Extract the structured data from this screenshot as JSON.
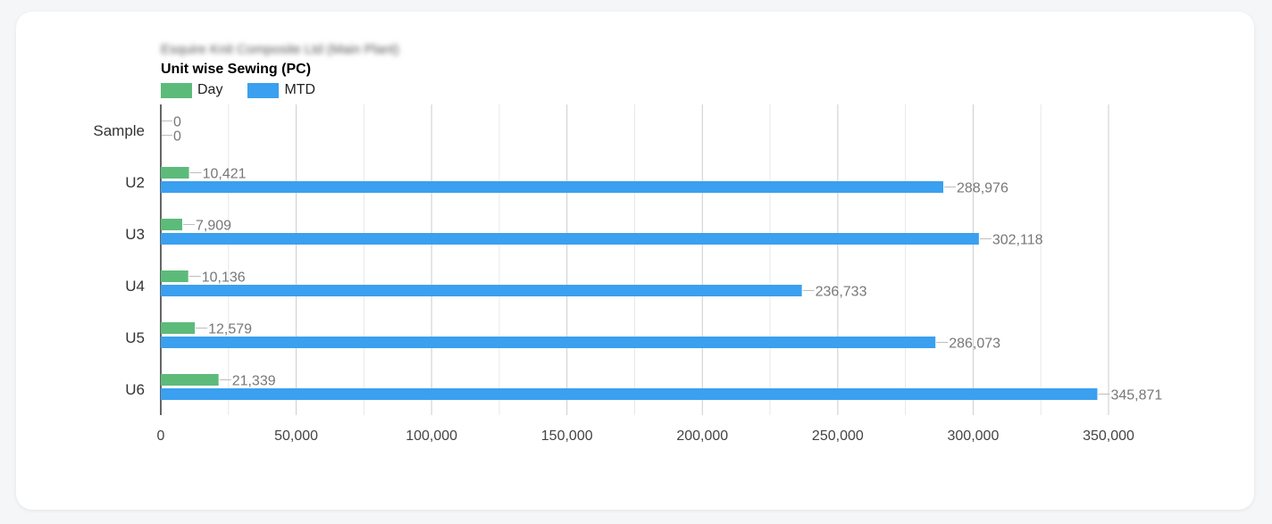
{
  "colors": {
    "day": "#5dbb7a",
    "mtd": "#3aa0ef",
    "grid_major": "#cccccc",
    "grid_minor": "#e8e8e8",
    "axis": "#333333",
    "label": "#777777"
  },
  "chart_data": {
    "type": "bar",
    "orientation": "horizontal",
    "subtitle": "Esquire Knit Composite Ltd (Main Plant)",
    "title": "Unit wise Sewing (PC)",
    "categories": [
      "Sample",
      "U2",
      "U3",
      "U4",
      "U5",
      "U6"
    ],
    "series": [
      {
        "name": "Day",
        "values": [
          0,
          10421,
          7909,
          10136,
          12579,
          21339
        ]
      },
      {
        "name": "MTD",
        "values": [
          0,
          288976,
          302118,
          236733,
          286073,
          345871
        ]
      }
    ],
    "value_labels": {
      "Day": [
        "0",
        "10,421",
        "7,909",
        "10,136",
        "12,579",
        "21,339"
      ],
      "MTD": [
        "0",
        "288,976",
        "302,118",
        "236,733",
        "286,073",
        "345,871"
      ]
    },
    "xlim": [
      0,
      350000
    ],
    "x_ticks": [
      0,
      50000,
      100000,
      150000,
      200000,
      250000,
      300000,
      350000
    ],
    "x_tick_labels": [
      "0",
      "50,000",
      "100,000",
      "150,000",
      "200,000",
      "250,000",
      "300,000",
      "350,000"
    ],
    "legend_position": "top-left",
    "grid": true
  }
}
